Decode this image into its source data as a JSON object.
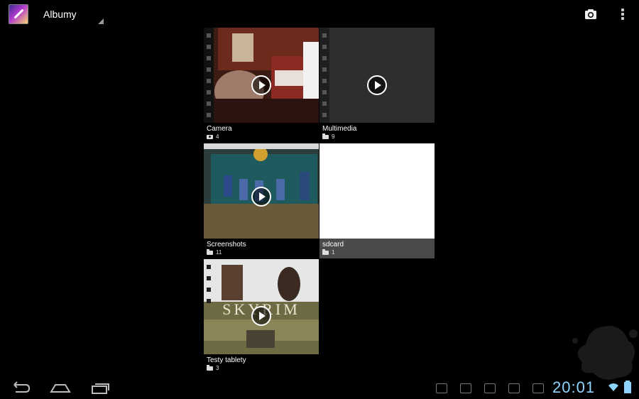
{
  "app_bar": {
    "title": "Albumy",
    "app_icon": "gallery-icon",
    "actions": [
      "camera-icon",
      "overflow-menu-icon"
    ]
  },
  "albums": [
    {
      "name": "Camera",
      "count": "4",
      "type_icon": "camera-icon",
      "has_play": true
    },
    {
      "name": "Multimedia",
      "count": "9",
      "type_icon": "folder-icon",
      "has_play": true
    },
    {
      "name": "Screenshots",
      "count": "11",
      "type_icon": "folder-icon",
      "has_play": true
    },
    {
      "name": "sdcard",
      "count": "1",
      "type_icon": "folder-icon",
      "has_play": false
    },
    {
      "name": "Testy tablety",
      "count": "3",
      "type_icon": "folder-icon",
      "has_play": true
    }
  ],
  "thumb_text": {
    "skyrim": "SKYRIM"
  },
  "system_bar": {
    "time": "20:01",
    "nav": [
      "back-icon",
      "home-icon",
      "recent-apps-icon"
    ]
  },
  "colors": {
    "background": "#000000",
    "clock": "#8fd3ff",
    "label_bar": "#4a4a4a"
  }
}
